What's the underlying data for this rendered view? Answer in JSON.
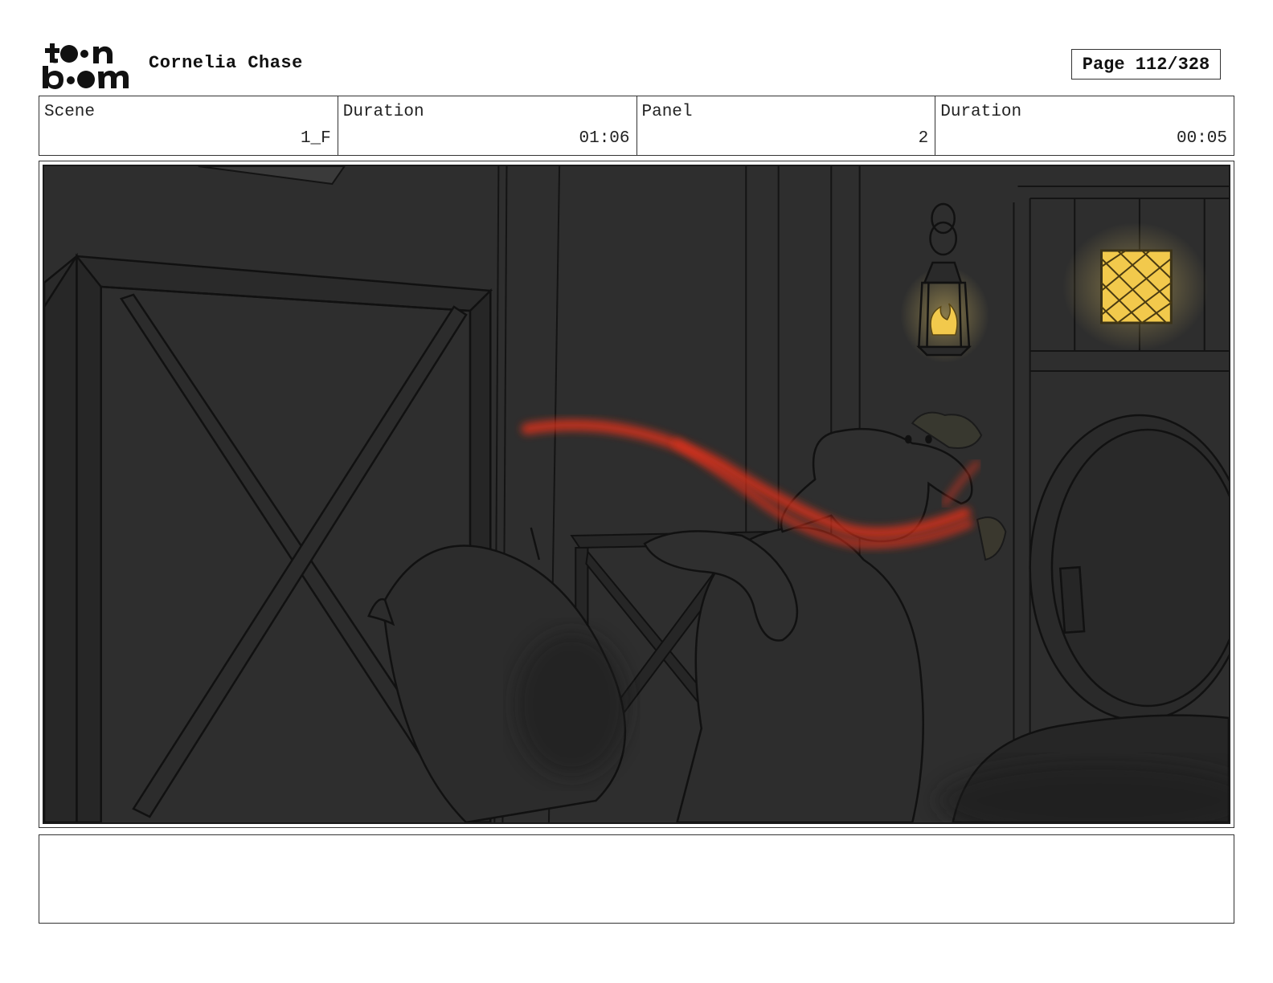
{
  "header": {
    "logo_text": "toonboom",
    "project_title": "Cornelia Chase",
    "page_label": "Page 112/328"
  },
  "info": {
    "scene_label": "Scene",
    "scene_value": "1_F",
    "scene_duration_label": "Duration",
    "scene_duration_value": "01:06",
    "panel_label": "Panel",
    "panel_value": "2",
    "panel_duration_label": "Duration",
    "panel_duration_value": "00:05"
  },
  "panel_image": {
    "icon": "storyboard-sketch-image",
    "accent_colors": {
      "background": "#2b2b2b",
      "lantern_glow": "#f2c94c",
      "motion_line": "#d9301b"
    }
  },
  "notes": {
    "text": ""
  }
}
